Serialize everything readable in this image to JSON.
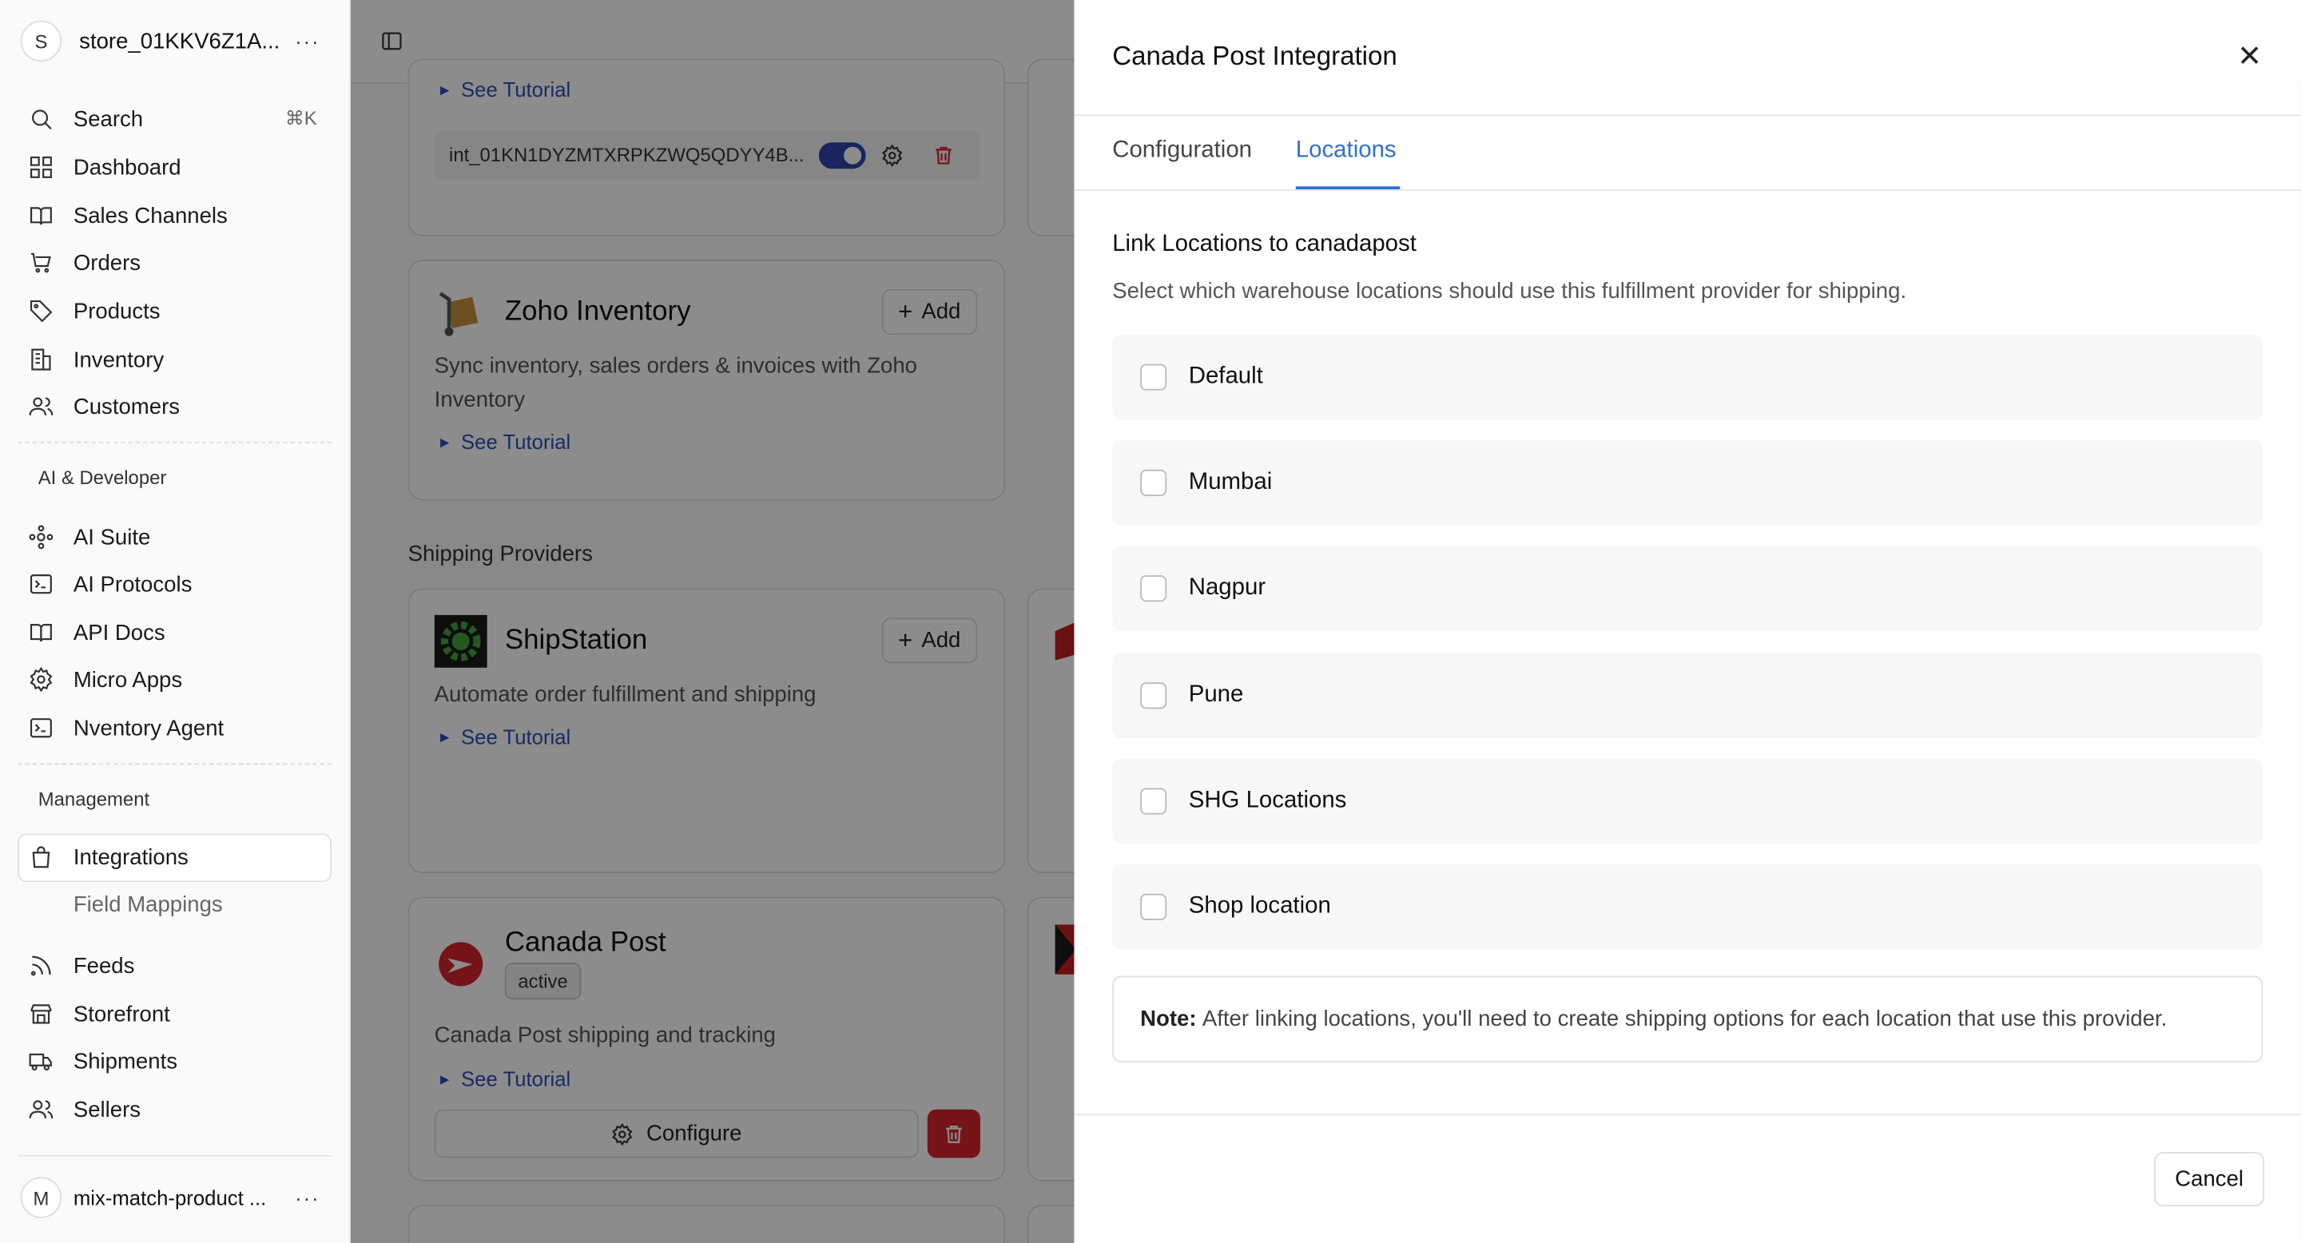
{
  "sidebar": {
    "store_avatar": "S",
    "store_name": "store_01KKV6Z1A...",
    "more": "···",
    "search_label": "Search",
    "search_shortcut": "⌘K",
    "items": [
      {
        "label": "Dashboard",
        "icon": "grid-icon"
      },
      {
        "label": "Sales Channels",
        "icon": "book-icon"
      },
      {
        "label": "Orders",
        "icon": "cart-icon"
      },
      {
        "label": "Products",
        "icon": "tag-icon"
      },
      {
        "label": "Inventory",
        "icon": "building-icon"
      },
      {
        "label": "Customers",
        "icon": "users-icon"
      }
    ],
    "group_ai": "AI & Developer",
    "ai_items": [
      {
        "label": "AI Suite",
        "icon": "ai-icon"
      },
      {
        "label": "AI Protocols",
        "icon": "terminal-icon"
      },
      {
        "label": "API Docs",
        "icon": "book-icon"
      },
      {
        "label": "Micro Apps",
        "icon": "gear-icon"
      },
      {
        "label": "Nventory Agent",
        "icon": "terminal-icon"
      }
    ],
    "group_mgmt": "Management",
    "mgmt_active": "Integrations",
    "mgmt_sub": "Field Mappings",
    "mgmt_items": [
      {
        "label": "Feeds",
        "icon": "rss-icon"
      },
      {
        "label": "Storefront",
        "icon": "store-icon"
      },
      {
        "label": "Shipments",
        "icon": "truck-icon"
      },
      {
        "label": "Sellers",
        "icon": "users-icon"
      }
    ],
    "user_avatar": "M",
    "user_name": "mix-match-product ..."
  },
  "main": {
    "tutorial_label": "See Tutorial",
    "integration_id": "int_01KN1DYZMTXRPKZWQ5QDYY4B...",
    "zoho": {
      "title": "Zoho Inventory",
      "desc": "Sync inventory, sales orders & invoices with Zoho Inventory",
      "add": "Add"
    },
    "shipping_header": "Shipping Providers",
    "shipstation": {
      "title": "ShipStation",
      "desc": "Automate order fulfillment and shipping",
      "add": "Add"
    },
    "canadapost": {
      "title": "Canada Post",
      "badge": "active",
      "desc": "Canada Post shipping and tracking",
      "configure": "Configure"
    }
  },
  "drawer": {
    "title": "Canada Post Integration",
    "tabs": [
      {
        "label": "Configuration"
      },
      {
        "label": "Locations"
      }
    ],
    "section_title": "Link Locations to canadapost",
    "section_desc": "Select which warehouse locations should use this fulfillment provider for shipping.",
    "locations": [
      "Default",
      "Mumbai",
      "Nagpur",
      "Pune",
      "SHG Locations",
      "Shop location"
    ],
    "note_label": "Note:",
    "note_text": "After linking locations, you'll need to create shipping options for each location that use this provider.",
    "cancel": "Cancel"
  },
  "colors": {
    "accent": "#2f6fd6",
    "danger": "#d7262e",
    "link": "#2f4fb8"
  }
}
